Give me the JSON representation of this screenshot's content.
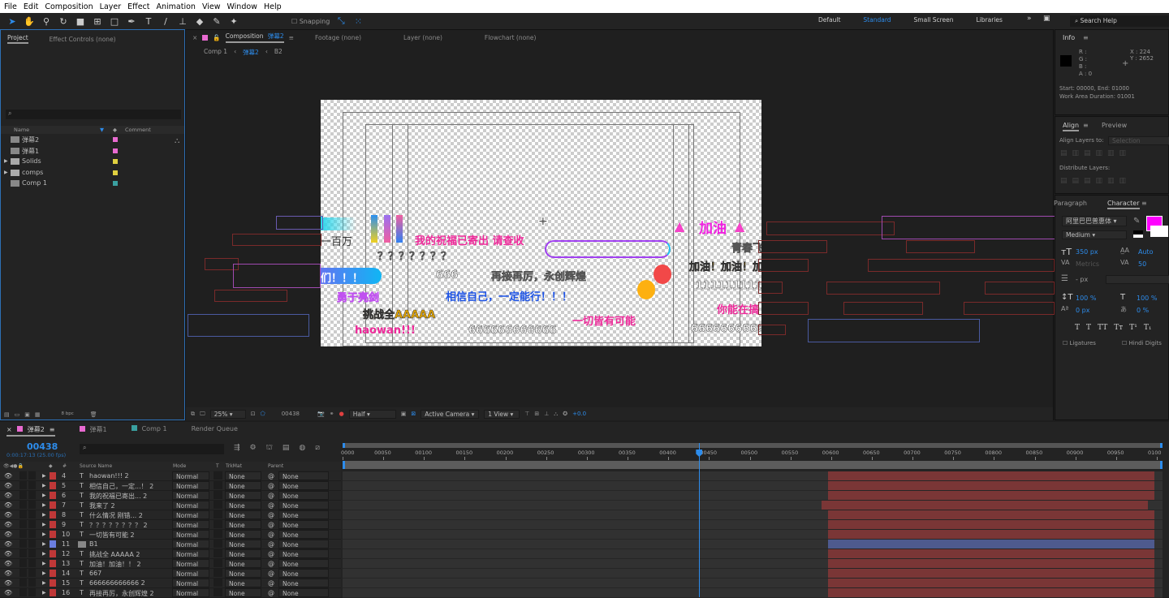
{
  "menu": [
    "File",
    "Edit",
    "Composition",
    "Layer",
    "Effect",
    "Animation",
    "View",
    "Window",
    "Help"
  ],
  "toolbar": {
    "snapping": "Snapping",
    "workspaces": [
      "Default",
      "Standard",
      "Small Screen",
      "Libraries"
    ],
    "active_workspace": "Standard",
    "search_placeholder": "Search Help"
  },
  "project": {
    "tabs": [
      "Project",
      "Effect Controls (none)"
    ],
    "columns": [
      "Name",
      "Comment"
    ],
    "items": [
      {
        "name": "弹幕2",
        "type": "comp",
        "color": "#e86ad0"
      },
      {
        "name": "弹幕1",
        "type": "comp",
        "color": "#e86ad0"
      },
      {
        "name": "Solids",
        "type": "folder",
        "color": "#e0d040"
      },
      {
        "name": "comps",
        "type": "folder",
        "color": "#e0d040"
      },
      {
        "name": "Comp 1",
        "type": "comp",
        "color": "#3aa0a0"
      }
    ],
    "bpc": "8 bpc"
  },
  "composition": {
    "tabs": [
      "Composition 弹幕2",
      "Footage (none)",
      "Layer (none)",
      "Flowchart (none)"
    ],
    "comp_label": "Composition",
    "comp_name": "弹幕2",
    "breadcrumb": [
      "Comp 1",
      "弹幕2",
      "B2"
    ],
    "viewer": {
      "zoom": "25%",
      "frame": "00438",
      "resolution": "Half",
      "camera": "Active Camera",
      "views": "1 View",
      "exposure": "+0.0"
    },
    "canvas_texts": [
      "一百万",
      "我的祝福已寄出 请查收",
      "？？？？？？？",
      "们！！！",
      "666",
      "再接再厉，永创辉煌",
      "勇于亮剑",
      "相信自己，一定能行！！！",
      "挑战全AAAAA",
      "一切皆有可能",
      "haowan!!!",
      "666666666666",
      "加油",
      "青春飞",
      "加油！加油！加",
      "11111111111",
      "你能在搞",
      "66666666666"
    ]
  },
  "info": {
    "title": "Info",
    "r": "R :",
    "g": "G :",
    "b": "B :",
    "a": "A :  0",
    "x": "X : 224",
    "y": "Y : 2652",
    "start_end": "Start: 00000, End: 01000",
    "duration": "Work Area Duration: 01001"
  },
  "align": {
    "tabs": [
      "Align",
      "Preview"
    ],
    "align_to_label": "Align Layers to:",
    "align_to": "Selection",
    "distribute": "Distribute Layers:"
  },
  "character": {
    "tabs": [
      "Paragraph",
      "Character"
    ],
    "font": "阿里巴巴普惠体",
    "style": "Medium",
    "fill_color": "#ff00ff",
    "size": "350 px",
    "leading": "Auto",
    "kerning": "Metrics",
    "tracking": "50",
    "stroke": "- px",
    "vscale": "100 %",
    "hscale": "100 %",
    "baseline": "0 px",
    "tsume": "0 %",
    "styles": [
      "T",
      "T",
      "TT",
      "Tт",
      "T¹",
      "T₁"
    ],
    "ligatures": "Ligatures",
    "hindi": "Hindi Digits"
  },
  "timeline": {
    "tabs": [
      {
        "name": "弹幕2",
        "color": "#e86ad0"
      },
      {
        "name": "弹幕1",
        "color": "#e86ad0"
      },
      {
        "name": "Comp 1",
        "color": "#3aa0a0"
      },
      {
        "name": "Render Queue",
        "color": ""
      }
    ],
    "current_frame": "00438",
    "timecode": "0:00:17:13 (25.00 fps)",
    "columns": [
      "#",
      "Source Name",
      "Mode",
      "T",
      "TrkMat",
      "Parent"
    ],
    "ruler": [
      "0000",
      "00050",
      "00100",
      "00150",
      "00200",
      "00250",
      "00300",
      "00350",
      "00400",
      "00450",
      "00500",
      "00550",
      "00600",
      "00650",
      "00700",
      "00750",
      "00800",
      "00850",
      "00900",
      "00950",
      "0100"
    ],
    "playhead_frame": 438,
    "duration_frames": 1000,
    "layers": [
      {
        "num": "4",
        "type": "T",
        "name": "haowan!!! 2",
        "color": "#c03838",
        "mode": "Normal",
        "trkmat": "None",
        "parent": "None",
        "in": 594,
        "out": 995
      },
      {
        "num": "5",
        "type": "T",
        "name": "相信自己，一定...！ 2",
        "color": "#c03838",
        "mode": "Normal",
        "trkmat": "None",
        "parent": "None",
        "in": 594,
        "out": 995
      },
      {
        "num": "6",
        "type": "T",
        "name": "我的祝福已寄出... 2",
        "color": "#c03838",
        "mode": "Normal",
        "trkmat": "None",
        "parent": "None",
        "in": 594,
        "out": 995
      },
      {
        "num": "7",
        "type": "T",
        "name": "我来了 2",
        "color": "#c03838",
        "mode": "Normal",
        "trkmat": "None",
        "parent": "None",
        "in": 586,
        "out": 987
      },
      {
        "num": "8",
        "type": "T",
        "name": "什么情况 刚错... 2",
        "color": "#c03838",
        "mode": "Normal",
        "trkmat": "None",
        "parent": "None",
        "in": 594,
        "out": 995
      },
      {
        "num": "9",
        "type": "T",
        "name": "？？？？？？？？ 2",
        "color": "#c03838",
        "mode": "Normal",
        "trkmat": "None",
        "parent": "None",
        "in": 594,
        "out": 995
      },
      {
        "num": "10",
        "type": "T",
        "name": "一切皆有可能 2",
        "color": "#c03838",
        "mode": "Normal",
        "trkmat": "None",
        "parent": "None",
        "in": 594,
        "out": 995
      },
      {
        "num": "11",
        "type": "comp",
        "name": "B1",
        "color": "#6a7ee0",
        "mode": "Normal",
        "trkmat": "None",
        "parent": "None",
        "in": 594,
        "out": 995
      },
      {
        "num": "12",
        "type": "T",
        "name": "挑战全 AAAAA 2",
        "color": "#c03838",
        "mode": "Normal",
        "trkmat": "None",
        "parent": "None",
        "in": 594,
        "out": 995
      },
      {
        "num": "13",
        "type": "T",
        "name": "加油！加油！！ 2",
        "color": "#c03838",
        "mode": "Normal",
        "trkmat": "None",
        "parent": "None",
        "in": 594,
        "out": 995
      },
      {
        "num": "14",
        "type": "T",
        "name": "667",
        "color": "#c03838",
        "mode": "Normal",
        "trkmat": "None",
        "parent": "None",
        "in": 594,
        "out": 995
      },
      {
        "num": "15",
        "type": "T",
        "name": "666666666666 2",
        "color": "#c03838",
        "mode": "Normal",
        "trkmat": "None",
        "parent": "None",
        "in": 594,
        "out": 995
      },
      {
        "num": "16",
        "type": "T",
        "name": "再接再厉，永创辉煌 2",
        "color": "#c03838",
        "mode": "Normal",
        "trkmat": "None",
        "parent": "None",
        "in": 594,
        "out": 995
      }
    ]
  }
}
